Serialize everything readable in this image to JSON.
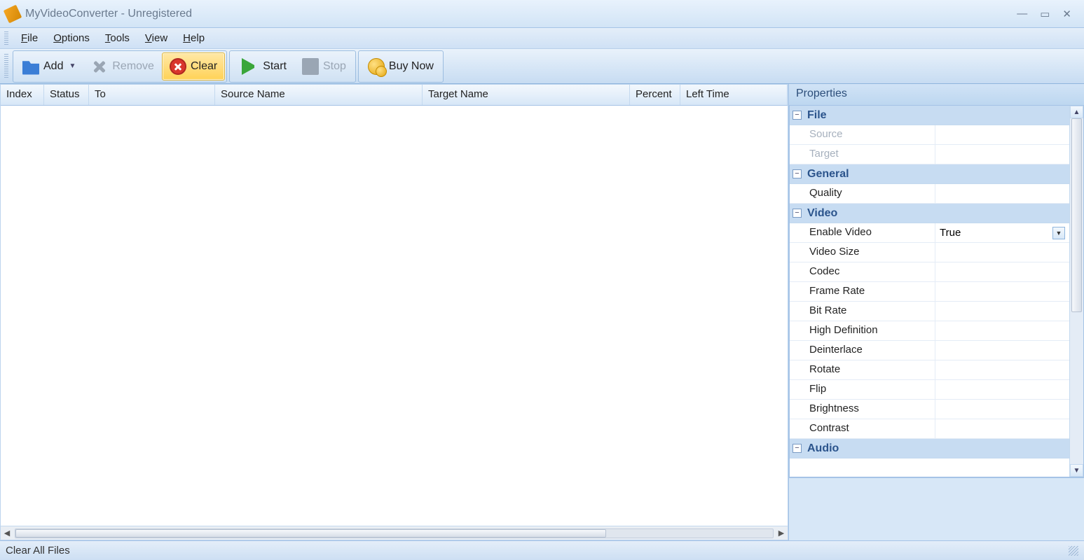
{
  "window": {
    "title": "MyVideoConverter - Unregistered"
  },
  "menu": {
    "items": [
      "File",
      "Options",
      "Tools",
      "View",
      "Help"
    ]
  },
  "toolbar": {
    "add": "Add",
    "remove": "Remove",
    "clear": "Clear",
    "start": "Start",
    "stop": "Stop",
    "buy": "Buy Now"
  },
  "table": {
    "headers": [
      "Index",
      "Status",
      "To",
      "Source Name",
      "Target Name",
      "Percent",
      "Left Time"
    ]
  },
  "properties": {
    "title": "Properties",
    "groups": [
      {
        "name": "File",
        "rows": [
          {
            "label": "Source",
            "value": "",
            "muted": true
          },
          {
            "label": "Target",
            "value": "",
            "muted": true
          }
        ]
      },
      {
        "name": "General",
        "rows": [
          {
            "label": "Quality",
            "value": ""
          }
        ]
      },
      {
        "name": "Video",
        "rows": [
          {
            "label": "Enable Video",
            "value": "True",
            "dropdown": true
          },
          {
            "label": "Video Size",
            "value": ""
          },
          {
            "label": "Codec",
            "value": ""
          },
          {
            "label": "Frame Rate",
            "value": ""
          },
          {
            "label": "Bit Rate",
            "value": ""
          },
          {
            "label": "High Definition",
            "value": ""
          },
          {
            "label": "Deinterlace",
            "value": ""
          },
          {
            "label": "Rotate",
            "value": ""
          },
          {
            "label": "Flip",
            "value": ""
          },
          {
            "label": "Brightness",
            "value": ""
          },
          {
            "label": "Contrast",
            "value": ""
          }
        ]
      },
      {
        "name": "Audio",
        "rows": []
      }
    ]
  },
  "statusbar": {
    "text": "Clear All Files"
  }
}
